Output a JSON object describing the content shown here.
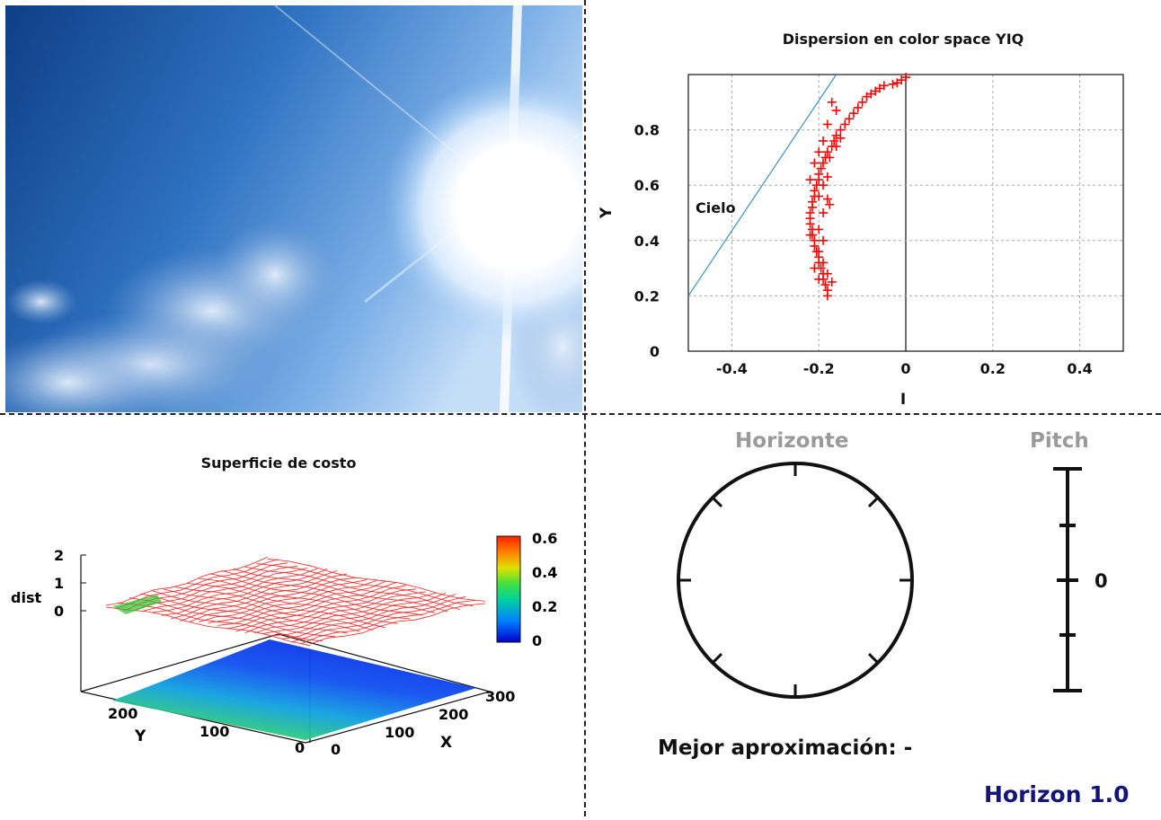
{
  "window": {
    "version_label": "Horizon 1.0"
  },
  "camera": {
    "scene": "sky-with-sun-and-clouds"
  },
  "scatter_plot": {
    "title": "Dispersion en color space YIQ",
    "xlabel": "I",
    "ylabel": "Y",
    "annotation": "Cielo",
    "colors": {
      "points": "#ff0000",
      "line": "#3a8fd6",
      "grid": "#aaaaaa"
    }
  },
  "surface_plot": {
    "title": "Superficie de costo",
    "zlabel": "dist",
    "xlabel": "X",
    "ylabel": "Y",
    "z_ticks": [
      "2",
      "1",
      "0"
    ],
    "x_ticks": [
      "0",
      "100",
      "200",
      "300"
    ],
    "y_ticks": [
      "0",
      "100",
      "200"
    ],
    "colorbar_ticks": [
      "0.6",
      "0.4",
      "0.2",
      "0"
    ],
    "colors": {
      "mesh": "#ff2020",
      "floor_low": "#1040ff",
      "floor_high": "#aee000"
    }
  },
  "horizon_indicator": {
    "title": "Horizonte",
    "pitch_title": "Pitch",
    "pitch_value": "0",
    "best_label": "Mejor aproximación:",
    "best_value": "-"
  },
  "chart_data": [
    {
      "type": "scatter",
      "title": "Dispersion en color space YIQ",
      "xlabel": "I",
      "ylabel": "Y",
      "xlim": [
        -0.5,
        0.5
      ],
      "ylim": [
        0,
        1
      ],
      "x_ticks": [
        -0.4,
        -0.2,
        0,
        0.2,
        0.4
      ],
      "y_ticks": [
        0,
        0.2,
        0.4,
        0.6,
        0.8
      ],
      "grid": true,
      "series": [
        {
          "marker": "+",
          "points": [
            [
              0.0,
              0.99
            ],
            [
              -0.01,
              0.98
            ],
            [
              -0.02,
              0.97
            ],
            [
              -0.03,
              0.965
            ],
            [
              -0.05,
              0.96
            ],
            [
              -0.06,
              0.95
            ],
            [
              -0.07,
              0.94
            ],
            [
              -0.08,
              0.93
            ],
            [
              -0.09,
              0.92
            ],
            [
              -0.1,
              0.9
            ],
            [
              -0.11,
              0.88
            ],
            [
              -0.12,
              0.86
            ],
            [
              -0.13,
              0.84
            ],
            [
              -0.14,
              0.82
            ],
            [
              -0.15,
              0.8
            ],
            [
              -0.16,
              0.78
            ],
            [
              -0.165,
              0.76
            ],
            [
              -0.17,
              0.74
            ],
            [
              -0.18,
              0.72
            ],
            [
              -0.185,
              0.7
            ],
            [
              -0.19,
              0.68
            ],
            [
              -0.195,
              0.66
            ],
            [
              -0.2,
              0.64
            ],
            [
              -0.2,
              0.62
            ],
            [
              -0.205,
              0.6
            ],
            [
              -0.21,
              0.58
            ],
            [
              -0.21,
              0.56
            ],
            [
              -0.215,
              0.54
            ],
            [
              -0.215,
              0.52
            ],
            [
              -0.22,
              0.5
            ],
            [
              -0.22,
              0.48
            ],
            [
              -0.22,
              0.46
            ],
            [
              -0.215,
              0.44
            ],
            [
              -0.215,
              0.42
            ],
            [
              -0.21,
              0.4
            ],
            [
              -0.21,
              0.38
            ],
            [
              -0.205,
              0.36
            ],
            [
              -0.2,
              0.34
            ],
            [
              -0.2,
              0.32
            ],
            [
              -0.195,
              0.3
            ],
            [
              -0.19,
              0.28
            ],
            [
              -0.19,
              0.26
            ],
            [
              -0.185,
              0.24
            ],
            [
              -0.18,
              0.22
            ],
            [
              -0.18,
              0.2
            ],
            [
              -0.17,
              0.9
            ],
            [
              -0.16,
              0.87
            ],
            [
              -0.18,
              0.82
            ],
            [
              -0.19,
              0.76
            ],
            [
              -0.2,
              0.72
            ],
            [
              -0.21,
              0.68
            ],
            [
              -0.22,
              0.62
            ],
            [
              -0.19,
              0.6
            ],
            [
              -0.2,
              0.56
            ],
            [
              -0.18,
              0.55
            ],
            [
              -0.19,
              0.5
            ],
            [
              -0.2,
              0.44
            ],
            [
              -0.19,
              0.4
            ],
            [
              -0.22,
              0.42
            ],
            [
              -0.2,
              0.36
            ],
            [
              -0.19,
              0.32
            ],
            [
              -0.21,
              0.3
            ],
            [
              -0.18,
              0.28
            ],
            [
              -0.17,
              0.25
            ],
            [
              -0.2,
              0.26
            ],
            [
              -0.175,
              0.53
            ],
            [
              -0.18,
              0.63
            ],
            [
              -0.175,
              0.7
            ],
            [
              -0.16,
              0.74
            ],
            [
              -0.15,
              0.77
            ]
          ]
        },
        {
          "type": "line",
          "points": [
            [
              -0.5,
              0.2
            ],
            [
              -0.16,
              1.0
            ]
          ]
        }
      ]
    },
    {
      "type": "surface",
      "title": "Superficie de costo",
      "xlabel": "X",
      "ylabel": "Y",
      "zlabel": "dist",
      "xlim": [
        0,
        320
      ],
      "ylim": [
        0,
        240
      ],
      "zlim": [
        0,
        2
      ],
      "colorbar_range": [
        0,
        0.6
      ]
    }
  ]
}
